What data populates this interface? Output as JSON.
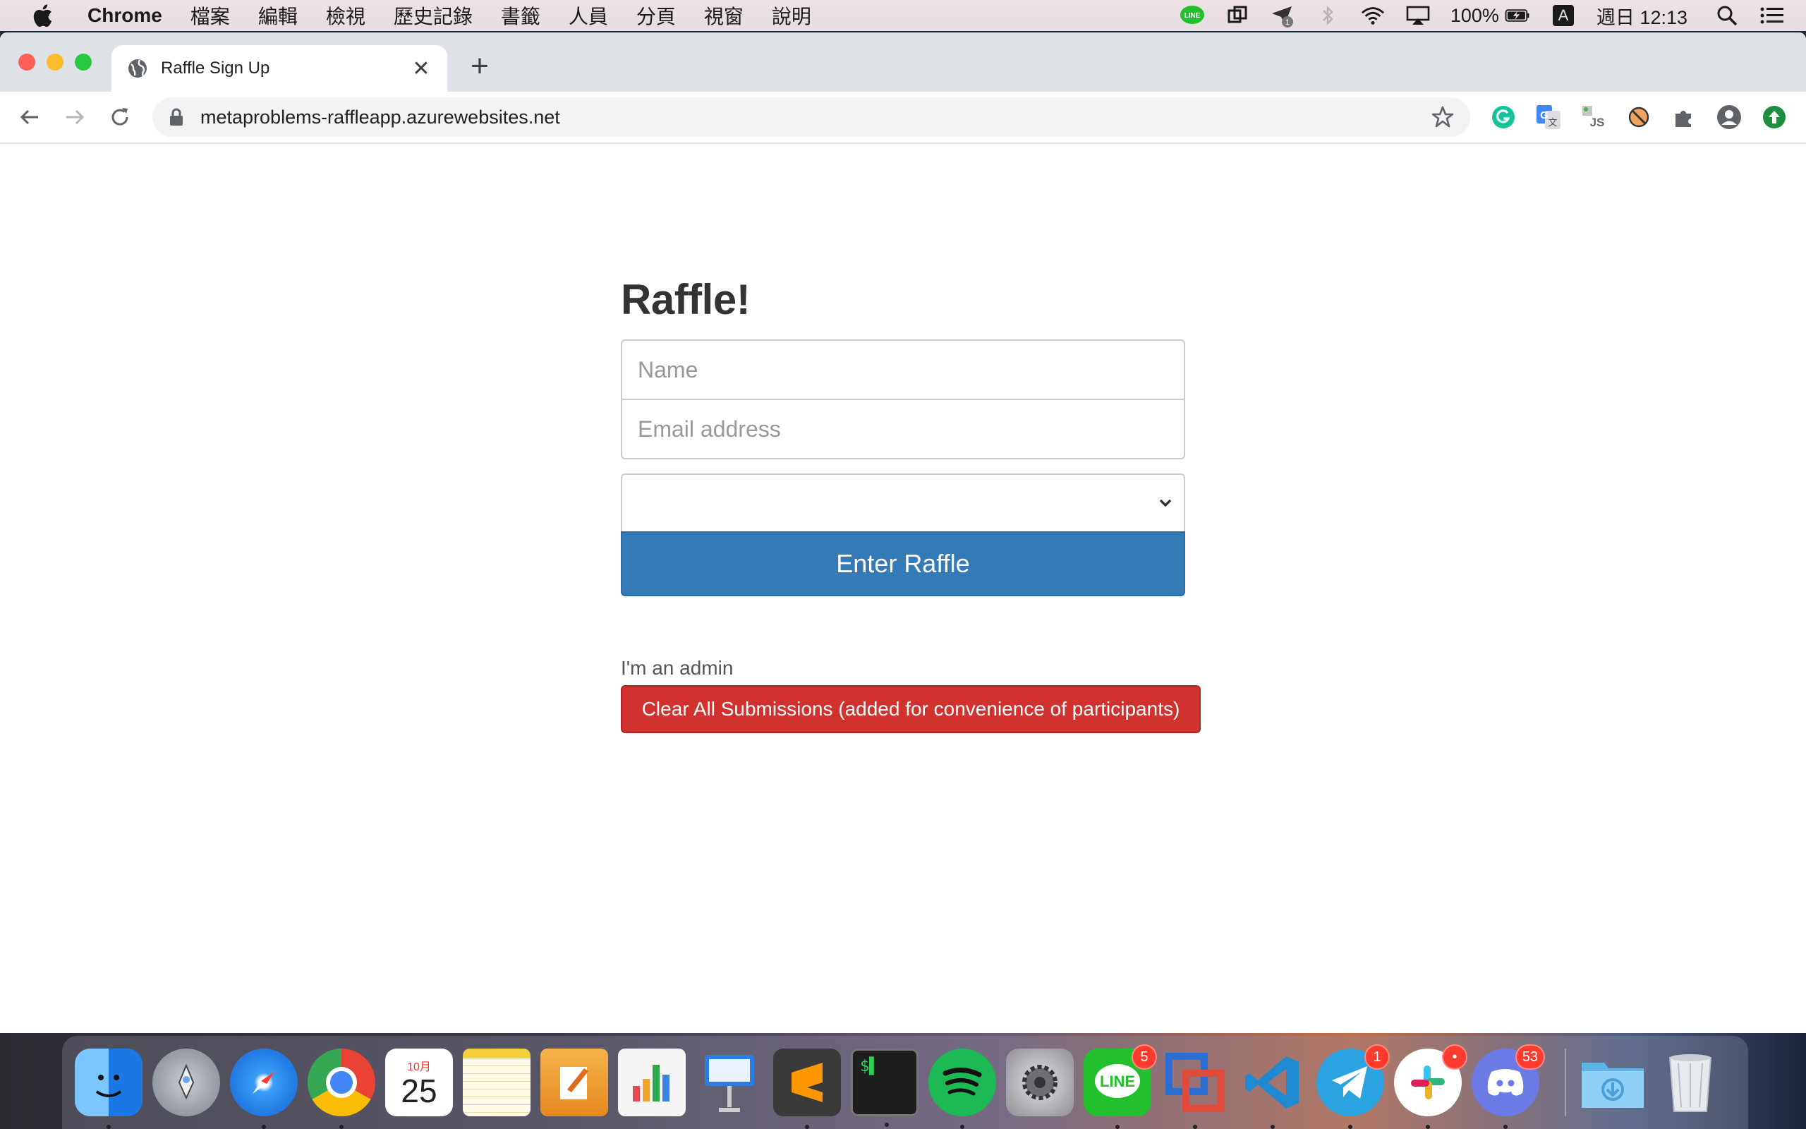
{
  "menubar": {
    "app_name": "Chrome",
    "items": [
      "檔案",
      "編輯",
      "檢視",
      "歷史記錄",
      "書籤",
      "人員",
      "分頁",
      "視窗",
      "說明"
    ],
    "battery": "100%",
    "input_source": "A",
    "clock": "週日 12:13",
    "tray_icons": [
      "line-icon",
      "crop-icon",
      "paper-plane-icon",
      "bluetooth-icon",
      "wifi-icon",
      "airplay-icon",
      "battery-icon",
      "input-source-icon",
      "spotlight-icon",
      "notification-center-icon"
    ]
  },
  "browser": {
    "tab_title": "Raffle Sign Up",
    "url": "metaproblems-raffleapp.azurewebsites.net",
    "extensions": [
      "grammarly-icon",
      "google-translate-icon",
      "js-icon",
      "blocker-icon",
      "puzzle-icon",
      "profile-icon",
      "update-icon"
    ]
  },
  "page": {
    "title": "Raffle!",
    "name_placeholder": "Name",
    "email_placeholder": "Email address",
    "select_value": "",
    "enter_button": "Enter Raffle",
    "admin_label": "I'm an admin",
    "clear_button": "Clear All Submissions (added for convenience of participants)"
  },
  "dock": {
    "calendar_month": "10月",
    "calendar_day": "25",
    "apps": [
      {
        "name": "finder",
        "color": "#3b8ff0",
        "running": true
      },
      {
        "name": "launchpad",
        "color": "#8a8f99",
        "running": false
      },
      {
        "name": "safari",
        "color": "#1b7cf2",
        "running": true
      },
      {
        "name": "chrome",
        "color": "#ffffff",
        "running": true
      },
      {
        "name": "calendar",
        "color": "#ffffff",
        "running": false
      },
      {
        "name": "notes",
        "color": "#f7e27a",
        "running": false
      },
      {
        "name": "pages",
        "color": "#f39a2f",
        "running": false
      },
      {
        "name": "numbers",
        "color": "#ffffff",
        "running": false
      },
      {
        "name": "keynote",
        "color": "#2a7de1",
        "running": false
      },
      {
        "name": "sublime-text",
        "color": "#3a3a3a",
        "running": true
      },
      {
        "name": "terminal",
        "color": "#222222",
        "running": true
      },
      {
        "name": "spotify",
        "color": "#1db954",
        "running": true
      },
      {
        "name": "system-preferences",
        "color": "#8e8e93",
        "running": false
      },
      {
        "name": "line",
        "color": "#22c02c",
        "running": true,
        "badge": "5"
      },
      {
        "name": "vmware",
        "color": "#2c6fd4",
        "running": true
      },
      {
        "name": "vscode",
        "color": "#1f8ad2",
        "running": true
      },
      {
        "name": "telegram",
        "color": "#2aa3e0",
        "running": true,
        "badge": "1"
      },
      {
        "name": "slack",
        "color": "#ffffff",
        "running": true,
        "badge": "•"
      },
      {
        "name": "discord",
        "color": "#6c7ae6",
        "running": true,
        "badge": "53"
      }
    ]
  },
  "colors": {
    "primary": "#337ab7",
    "danger": "#d2322d"
  }
}
